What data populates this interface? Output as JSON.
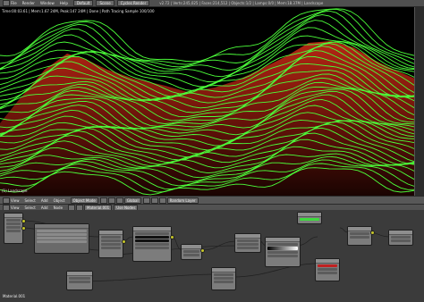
{
  "topbar": {
    "menus": [
      "File",
      "Render",
      "Window",
      "Help"
    ],
    "layout": "Default",
    "scene": "Scene",
    "engine": "Cycles Render",
    "info": "v2.72 | Verts:245,025 | Faces:214,512 | Objects:1/2 | Lamps:0/0 | Mem:18.37M | Landscape"
  },
  "viewport": {
    "stats": "Time:00:03.61 | Mem:1.67 24M, Peak:147 24M | Done | Path Tracing Sample 100/100",
    "object": "(1) Landscape"
  },
  "viewport_header": {
    "view": "View",
    "select": "Select",
    "add": "Add",
    "object": "Object",
    "mode": "Object Mode",
    "pivot": "Global",
    "layer": "Random Layer"
  },
  "node_header": {
    "view": "View",
    "select": "Select",
    "add": "Add",
    "node": "Node",
    "material": "Material.001",
    "use_nodes": "Use Nodes"
  },
  "node_editor": {
    "material_label": "Material.001"
  },
  "colors": {
    "contour": "#4cff3a",
    "terrain": "#8a1d10",
    "node_bg": "#3b3b3b"
  }
}
